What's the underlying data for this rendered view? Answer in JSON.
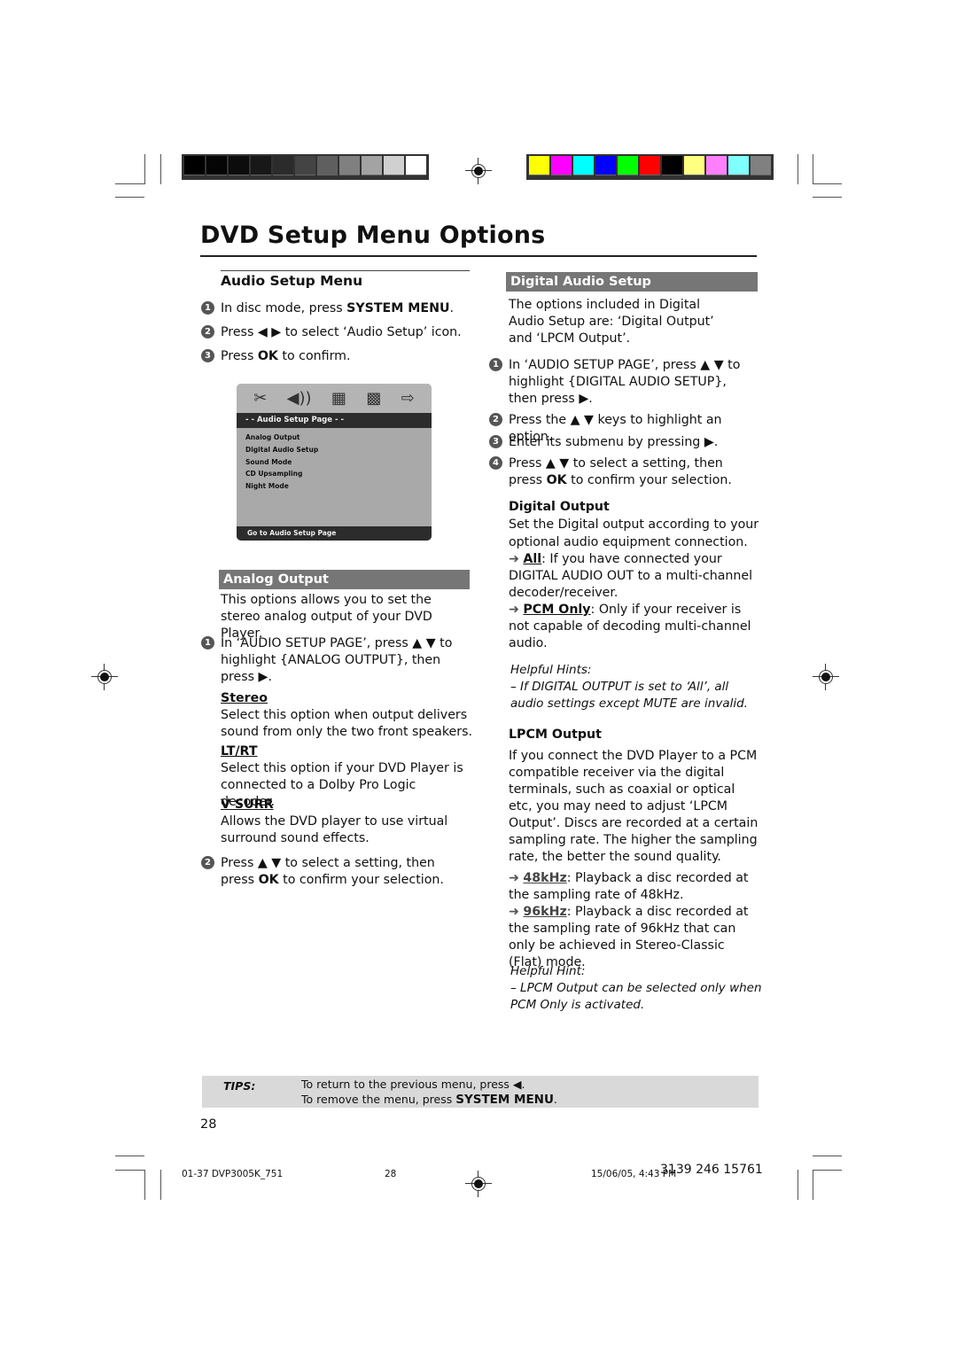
{
  "registration": {
    "gray_swatches": [
      "#000000",
      "#050505",
      "#0c0c0c",
      "#181818",
      "#2b2b2b",
      "#444444",
      "#5f5f5f",
      "#808080",
      "#a3a3a3",
      "#d0d0d0",
      "#ffffff"
    ],
    "color_swatches": [
      "#ffff00",
      "#ff00ff",
      "#00ffff",
      "#0000ff",
      "#00ff00",
      "#ff0000",
      "#000000",
      "#ffff80",
      "#ff80ff",
      "#80ffff",
      "#808080"
    ]
  },
  "page_title": "DVD Setup Menu Options",
  "left": {
    "heading": "Audio Setup Menu",
    "steps": [
      {
        "n": "1",
        "pre": "In disc mode, press ",
        "bold": "SYSTEM MENU",
        "post": "."
      },
      {
        "n": "2",
        "text": "Press ◀ ▶ to select ‘Audio Setup’ icon."
      },
      {
        "n": "3",
        "pre": "Press ",
        "bold": "OK",
        "post": " to confirm."
      }
    ],
    "osd": {
      "icons": [
        "tools-icon",
        "speaker-icon",
        "video-icon",
        "grid-icon",
        "exit-icon"
      ],
      "icon_glyphs": [
        "✂",
        "◀))",
        "▦",
        "▩",
        "⇨"
      ],
      "header": "- -   Audio Setup Page   - -",
      "items": [
        "Analog Output",
        "Digital Audio Setup",
        "Sound Mode",
        "CD Upsampling",
        "Night Mode"
      ],
      "footer": "Go to Audio Setup Page"
    },
    "analog": {
      "band": "Analog Output",
      "intro": "This options allows you to set the stereo analog output of your DVD Player.",
      "step1_n": "1",
      "step1": "In ‘AUDIO SETUP PAGE’, press ▲ ▼ to highlight {ANALOG OUTPUT}, then press ▶.",
      "options": [
        {
          "name": "Stereo",
          "desc": "Select this option when output delivers sound from only the two front speakers."
        },
        {
          "name": "LT/RT",
          "desc": "Select this option if your DVD Player is connected to a Dolby Pro Logic decoder."
        },
        {
          "name": "V SURR",
          "desc": "Allows the DVD player to use virtual surround sound effects."
        }
      ],
      "step2_n": "2",
      "step2_pre": "Press ▲ ▼ to select a setting, then press ",
      "step2_bold": "OK",
      "step2_post": " to confirm your selection."
    }
  },
  "right": {
    "band": "Digital Audio Setup",
    "intro": "The options included in Digital Audio Setup are: ‘Digital Output’ and ‘LPCM Output’.",
    "steps": [
      {
        "n": "1",
        "text": "In ‘AUDIO SETUP PAGE’, press ▲ ▼ to highlight {DIGITAL AUDIO SETUP}, then press ▶."
      },
      {
        "n": "2",
        "text": "Press the ▲ ▼ keys to highlight an option."
      },
      {
        "n": "3",
        "text": "Enter its submenu by pressing ▶."
      },
      {
        "n": "4",
        "pre": "Press ▲ ▼ to select a setting, then press ",
        "bold": "OK",
        "post": " to confirm your selection."
      }
    ],
    "digital_output": {
      "heading": "Digital Output",
      "desc": "Set the Digital output according to your optional audio equipment connection.",
      "options": [
        {
          "arrow": "➜",
          "name": "All",
          "desc": ": If you have connected your DIGITAL AUDIO OUT to a multi-channel decoder/receiver."
        },
        {
          "arrow": "➜",
          "name": "PCM Only",
          "desc": ": Only if your receiver is not capable of decoding multi-channel audio."
        }
      ],
      "hint_title": "Helpful Hints:",
      "hint": "–    If DIGITAL OUTPUT is set to ‘All’, all audio settings except MUTE are invalid."
    },
    "lpcm": {
      "heading": "LPCM Output",
      "desc": "If you connect the DVD Player to a PCM compatible receiver via the digital terminals, such as coaxial or optical etc, you may need to adjust ‘LPCM Output’. Discs are recorded at a certain sampling rate. The higher the sampling rate, the better the sound quality.",
      "options": [
        {
          "arrow": "➜",
          "name": "48kHz",
          "desc": ": Playback a disc recorded at the sampling rate of 48kHz."
        },
        {
          "arrow": "➜",
          "name": "96kHz",
          "desc": ": Playback a disc recorded at the sampling rate of 96kHz that can only be achieved in Stereo-Classic (Flat) mode."
        }
      ],
      "hint_title": "Helpful Hint:",
      "hint": "–    LPCM Output can be selected only when PCM Only is activated."
    }
  },
  "tips": {
    "label": "TIPS:",
    "line1": "To return to the previous menu, press ◀.",
    "line2_pre": "To remove the menu, press ",
    "line2_bold": "SYSTEM MENU",
    "line2_post": "."
  },
  "page_number": "28",
  "footer": {
    "file": "01-37 DVP3005K_751",
    "page": "28",
    "datetime": "15/06/05, 4:43 PM",
    "code": "3139 246 15761"
  }
}
